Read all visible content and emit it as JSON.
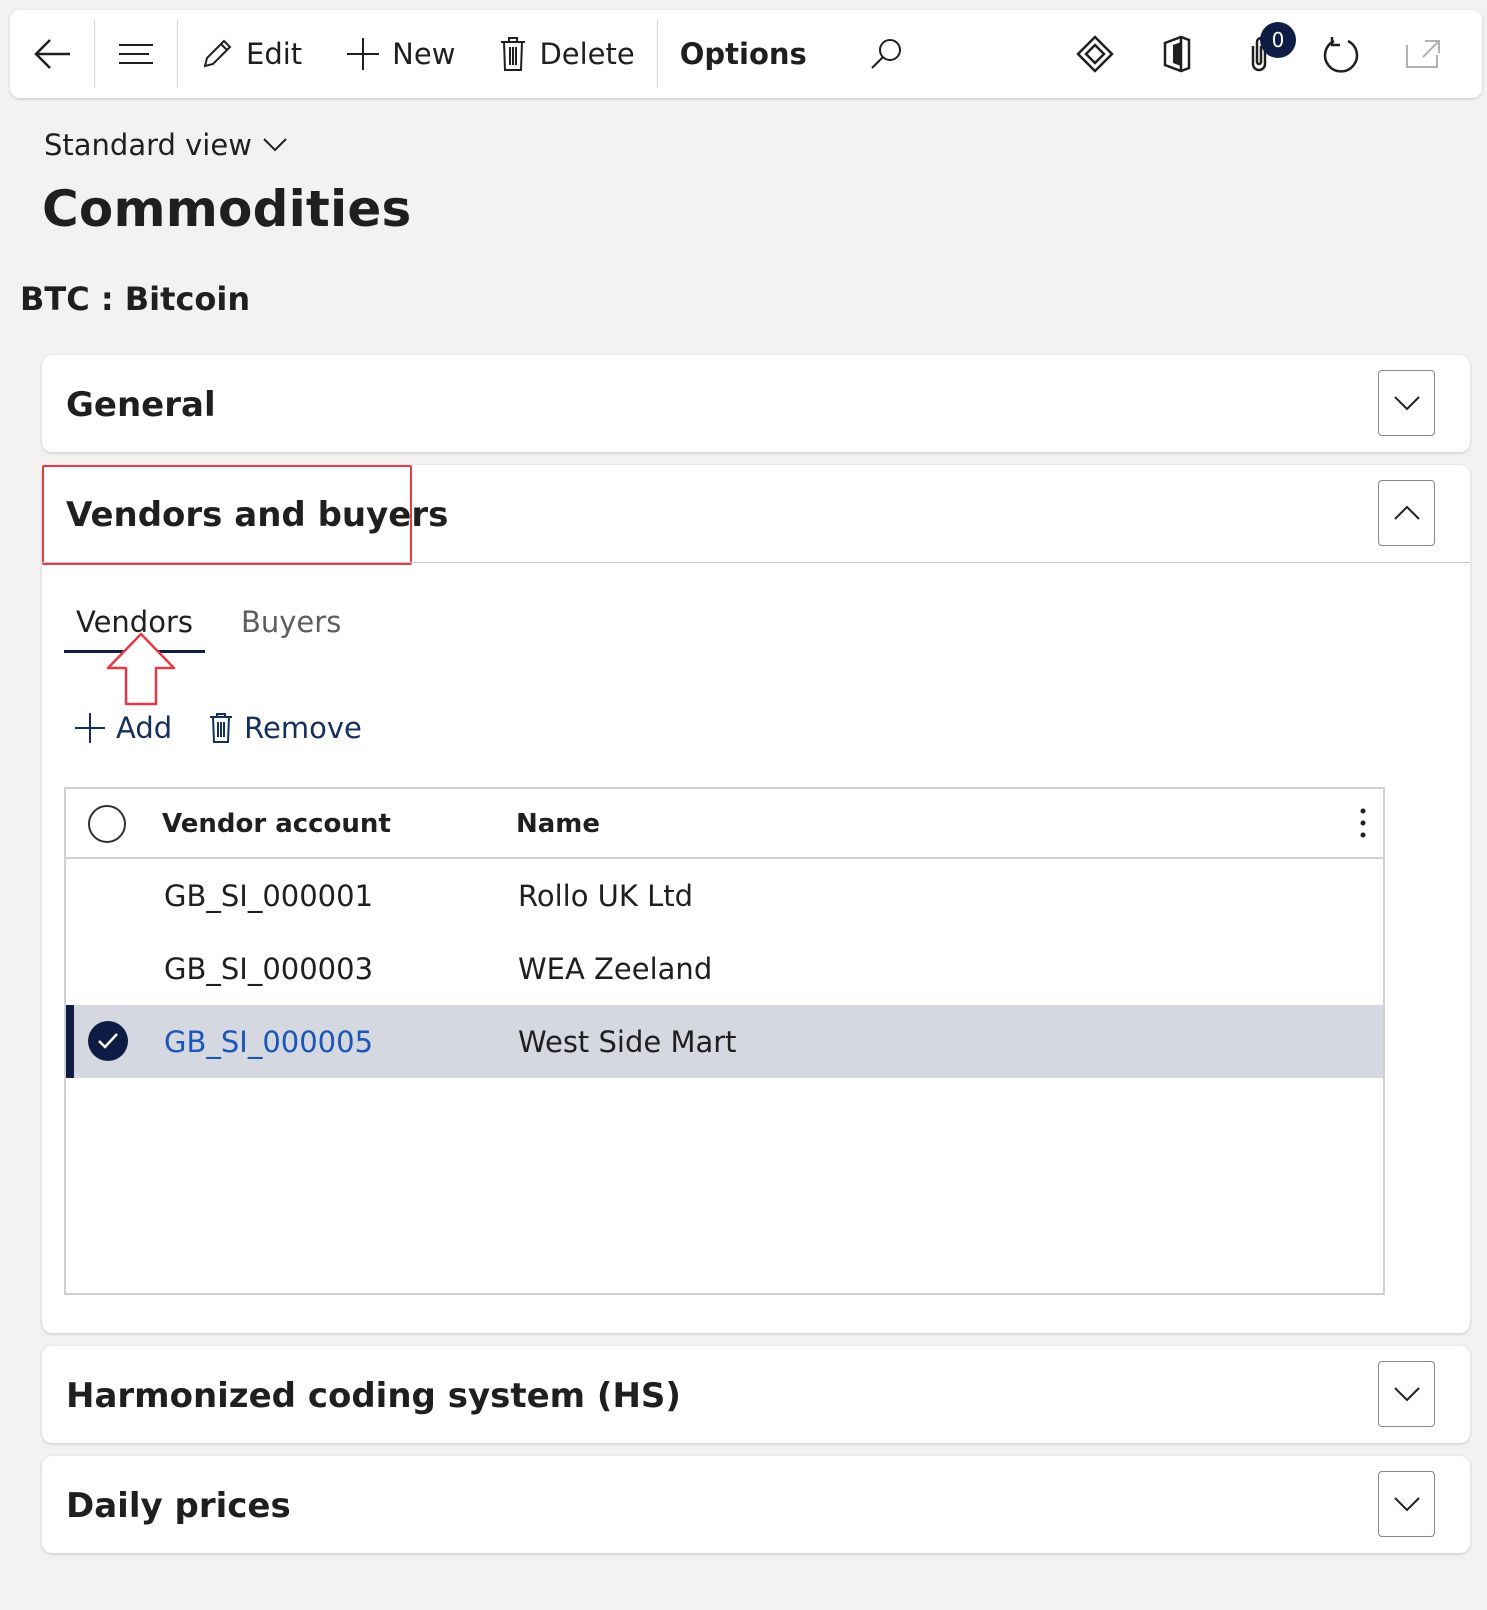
{
  "toolbar": {
    "edit_label": "Edit",
    "new_label": "New",
    "delete_label": "Delete",
    "options_label": "Options",
    "attachments_count": "0"
  },
  "page": {
    "view_selector": "Standard view",
    "title": "Commodities",
    "record": "BTC : Bitcoin"
  },
  "fasttabs": {
    "general": "General",
    "vendors_buyers": "Vendors and buyers",
    "hs": "Harmonized coding system (HS)",
    "daily_prices": "Daily prices"
  },
  "tabs": {
    "vendors": "Vendors",
    "buyers": "Buyers"
  },
  "grid_actions": {
    "add": "Add",
    "remove": "Remove"
  },
  "grid": {
    "columns": [
      "Vendor account",
      "Name"
    ],
    "rows": [
      {
        "account": "GB_SI_000001",
        "name": "Rollo UK Ltd"
      },
      {
        "account": "GB_SI_000003",
        "name": "WEA Zeeland"
      },
      {
        "account": "GB_SI_000005",
        "name": "West Side Mart"
      }
    ]
  },
  "colors": {
    "accent": "#0f1d45",
    "link": "#1a55b8",
    "highlight": "#e63946",
    "selected_row": "#d5d8e1"
  }
}
